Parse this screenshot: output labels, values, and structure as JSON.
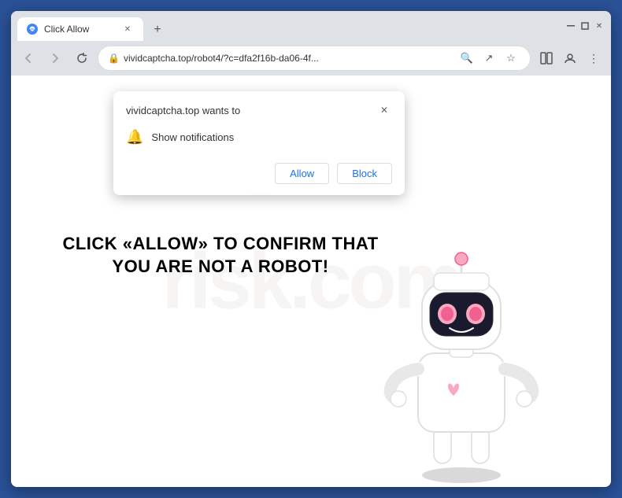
{
  "window": {
    "title": "Click Allow",
    "tab_title": "Click Allow",
    "url": "vividcaptcha.top/robot4/?c=dfa2f16b-da06-4f...",
    "url_display": "vividcaptcha.top/robot4/?c=dfa2f16b-da06-4f..."
  },
  "toolbar": {
    "back_label": "←",
    "forward_label": "→",
    "reload_label": "↻",
    "new_tab_label": "+",
    "minimize_label": "−",
    "maximize_label": "□",
    "close_label": "✕",
    "search_icon": "🔍",
    "share_icon": "↗",
    "bookmark_icon": "☆",
    "split_icon": "▭",
    "profile_icon": "👤",
    "more_icon": "⋮"
  },
  "popup": {
    "site_text": "vividcaptcha.top wants to",
    "notification_text": "Show notifications",
    "allow_label": "Allow",
    "block_label": "Block",
    "close_label": "✕"
  },
  "page": {
    "message": "CLICK «ALLOW» TO CONFIRM THAT YOU ARE NOT A ROBOT!",
    "watermark": "risk.com"
  }
}
